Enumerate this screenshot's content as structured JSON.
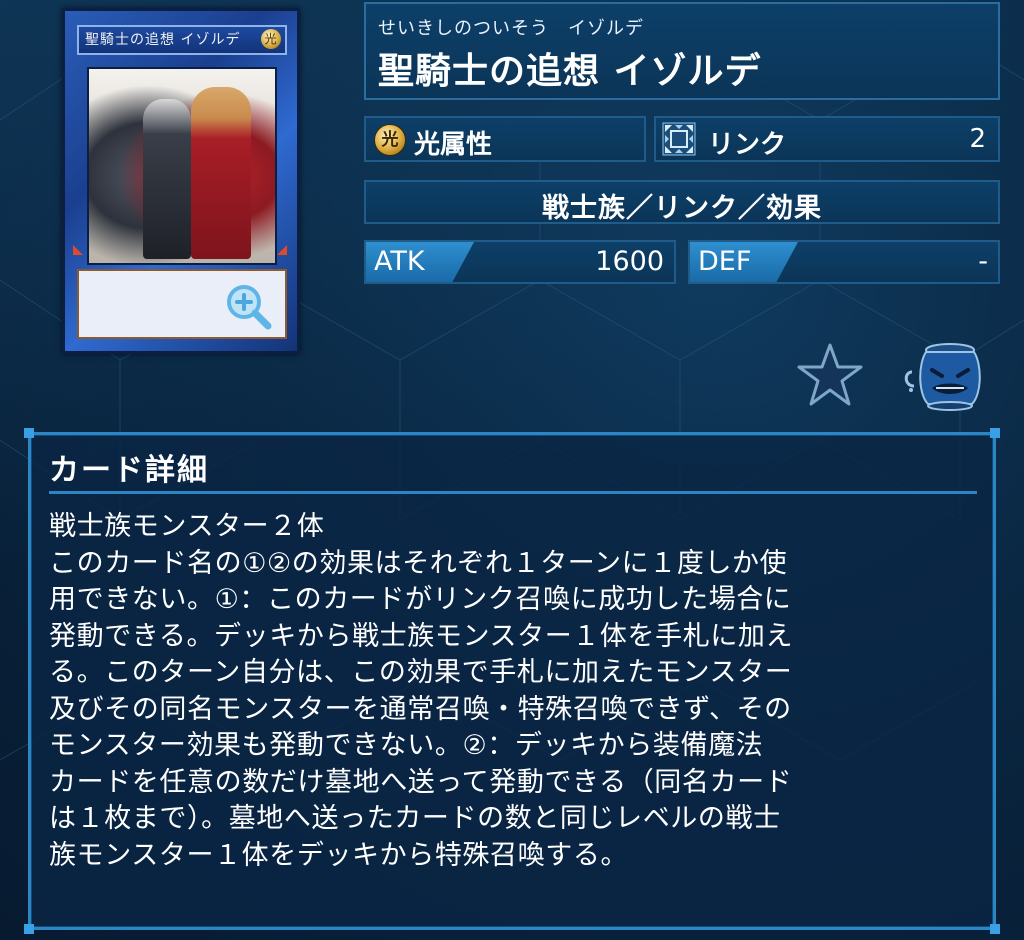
{
  "card": {
    "ruby": "せいきしのついそう　イゾルデ",
    "name": "聖騎士の追想 イゾルデ",
    "attribute_label": "光属性",
    "attribute_glyph": "光",
    "link_label": "リンク",
    "link_rating": "2",
    "type_line": "戦士族／リンク／効果",
    "atk_label": "ATK",
    "atk_value": "1600",
    "def_label": "DEF",
    "def_value": "-"
  },
  "detail": {
    "heading": "カード詳細",
    "lines": [
      "戦士族モンスター２体",
      "このカード名の①②の効果はそれぞれ１ターンに１度しか使",
      "用できない。①：このカードがリンク召喚に成功した場合に",
      "発動できる。デッキから戦士族モンスター１体を手札に加え",
      "る。このターン自分は、この効果で手札に加えたモンスター",
      "及びその同名モンスターを通常召喚・特殊召喚できず、その",
      "モンスター効果も発動できない。②：デッキから装備魔法",
      "カードを任意の数だけ墓地へ送って発動できる（同名カード",
      "は１枚まで）。墓地へ送ったカードの数と同じレベルの戦士",
      "族モンスター１体をデッキから特殊召喚する。"
    ]
  },
  "icons": {
    "zoom": "zoom-in-icon",
    "favorite": "star-icon",
    "pot": "pot-of-greed-icon",
    "link_marker": "link-marker-icon",
    "attribute": "light-attribute-icon"
  },
  "colors": {
    "background": "#0a2742",
    "panel_border": "#2d86c4",
    "tag": "#2f8fd0"
  }
}
